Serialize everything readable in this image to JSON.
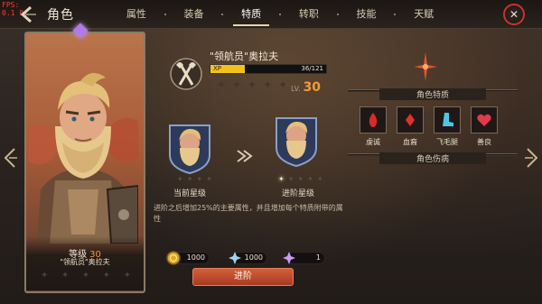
{
  "debug": {
    "fps_line1": "FPS:",
    "fps_line2": "0.1 0"
  },
  "header": {
    "title": "角色",
    "tabs": [
      {
        "label": "属性"
      },
      {
        "label": "装备"
      },
      {
        "label": "特质",
        "active": true
      },
      {
        "label": "转职"
      },
      {
        "label": "技能"
      },
      {
        "label": "天赋"
      }
    ]
  },
  "hero_card": {
    "level_label": "等级",
    "level": "30",
    "name": "\"领航员\"奥拉夫",
    "stars": 5
  },
  "hero_header": {
    "name": "\"领航员\"奥拉夫",
    "xp_label": "XP",
    "xp_value": "36/121",
    "xp_fraction": 0.2975,
    "stars": 5,
    "lv_label": "LV.",
    "lv_value": "30"
  },
  "promotion": {
    "current_label": "当前星级",
    "next_label": "进阶星级",
    "description": "进阶之后增加25%的主要属性，并且增加每个特质附带的属性",
    "costs": [
      {
        "icon": "gold-coin-icon",
        "value": "1000"
      },
      {
        "icon": "blue-crystal-icon",
        "value": "1000"
      },
      {
        "icon": "purple-crystal-icon",
        "value": "1"
      }
    ],
    "advance_label": "进阶"
  },
  "traits": {
    "section_label": "角色特质",
    "items": [
      {
        "label": "虔诚",
        "icon": "flame-icon"
      },
      {
        "label": "血裔",
        "icon": "blood-drop-icon"
      },
      {
        "label": "飞毛腿",
        "icon": "boot-icon"
      },
      {
        "label": "善良",
        "icon": "heart-icon"
      }
    ],
    "injury_label": "角色伤病"
  },
  "colors": {
    "accent_orange": "#f39a3a",
    "xp_yellow": "#f2c21c",
    "close_red": "#c8342a",
    "advance_button": "#c04a2c"
  }
}
